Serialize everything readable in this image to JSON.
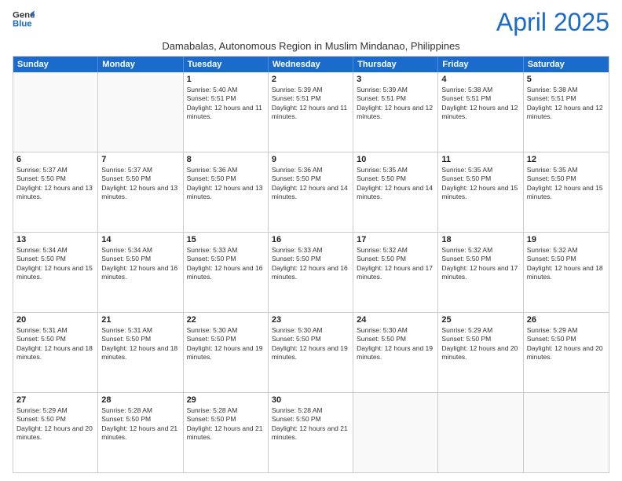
{
  "logo": {
    "line1": "General",
    "line2": "Blue"
  },
  "title": "April 2025",
  "subtitle": "Damabalas, Autonomous Region in Muslim Mindanao, Philippines",
  "header_days": [
    "Sunday",
    "Monday",
    "Tuesday",
    "Wednesday",
    "Thursday",
    "Friday",
    "Saturday"
  ],
  "rows": [
    [
      {
        "day": "",
        "text": ""
      },
      {
        "day": "",
        "text": ""
      },
      {
        "day": "1",
        "text": "Sunrise: 5:40 AM\nSunset: 5:51 PM\nDaylight: 12 hours and 11 minutes."
      },
      {
        "day": "2",
        "text": "Sunrise: 5:39 AM\nSunset: 5:51 PM\nDaylight: 12 hours and 11 minutes."
      },
      {
        "day": "3",
        "text": "Sunrise: 5:39 AM\nSunset: 5:51 PM\nDaylight: 12 hours and 12 minutes."
      },
      {
        "day": "4",
        "text": "Sunrise: 5:38 AM\nSunset: 5:51 PM\nDaylight: 12 hours and 12 minutes."
      },
      {
        "day": "5",
        "text": "Sunrise: 5:38 AM\nSunset: 5:51 PM\nDaylight: 12 hours and 12 minutes."
      }
    ],
    [
      {
        "day": "6",
        "text": "Sunrise: 5:37 AM\nSunset: 5:50 PM\nDaylight: 12 hours and 13 minutes."
      },
      {
        "day": "7",
        "text": "Sunrise: 5:37 AM\nSunset: 5:50 PM\nDaylight: 12 hours and 13 minutes."
      },
      {
        "day": "8",
        "text": "Sunrise: 5:36 AM\nSunset: 5:50 PM\nDaylight: 12 hours and 13 minutes."
      },
      {
        "day": "9",
        "text": "Sunrise: 5:36 AM\nSunset: 5:50 PM\nDaylight: 12 hours and 14 minutes."
      },
      {
        "day": "10",
        "text": "Sunrise: 5:35 AM\nSunset: 5:50 PM\nDaylight: 12 hours and 14 minutes."
      },
      {
        "day": "11",
        "text": "Sunrise: 5:35 AM\nSunset: 5:50 PM\nDaylight: 12 hours and 15 minutes."
      },
      {
        "day": "12",
        "text": "Sunrise: 5:35 AM\nSunset: 5:50 PM\nDaylight: 12 hours and 15 minutes."
      }
    ],
    [
      {
        "day": "13",
        "text": "Sunrise: 5:34 AM\nSunset: 5:50 PM\nDaylight: 12 hours and 15 minutes."
      },
      {
        "day": "14",
        "text": "Sunrise: 5:34 AM\nSunset: 5:50 PM\nDaylight: 12 hours and 16 minutes."
      },
      {
        "day": "15",
        "text": "Sunrise: 5:33 AM\nSunset: 5:50 PM\nDaylight: 12 hours and 16 minutes."
      },
      {
        "day": "16",
        "text": "Sunrise: 5:33 AM\nSunset: 5:50 PM\nDaylight: 12 hours and 16 minutes."
      },
      {
        "day": "17",
        "text": "Sunrise: 5:32 AM\nSunset: 5:50 PM\nDaylight: 12 hours and 17 minutes."
      },
      {
        "day": "18",
        "text": "Sunrise: 5:32 AM\nSunset: 5:50 PM\nDaylight: 12 hours and 17 minutes."
      },
      {
        "day": "19",
        "text": "Sunrise: 5:32 AM\nSunset: 5:50 PM\nDaylight: 12 hours and 18 minutes."
      }
    ],
    [
      {
        "day": "20",
        "text": "Sunrise: 5:31 AM\nSunset: 5:50 PM\nDaylight: 12 hours and 18 minutes."
      },
      {
        "day": "21",
        "text": "Sunrise: 5:31 AM\nSunset: 5:50 PM\nDaylight: 12 hours and 18 minutes."
      },
      {
        "day": "22",
        "text": "Sunrise: 5:30 AM\nSunset: 5:50 PM\nDaylight: 12 hours and 19 minutes."
      },
      {
        "day": "23",
        "text": "Sunrise: 5:30 AM\nSunset: 5:50 PM\nDaylight: 12 hours and 19 minutes."
      },
      {
        "day": "24",
        "text": "Sunrise: 5:30 AM\nSunset: 5:50 PM\nDaylight: 12 hours and 19 minutes."
      },
      {
        "day": "25",
        "text": "Sunrise: 5:29 AM\nSunset: 5:50 PM\nDaylight: 12 hours and 20 minutes."
      },
      {
        "day": "26",
        "text": "Sunrise: 5:29 AM\nSunset: 5:50 PM\nDaylight: 12 hours and 20 minutes."
      }
    ],
    [
      {
        "day": "27",
        "text": "Sunrise: 5:29 AM\nSunset: 5:50 PM\nDaylight: 12 hours and 20 minutes."
      },
      {
        "day": "28",
        "text": "Sunrise: 5:28 AM\nSunset: 5:50 PM\nDaylight: 12 hours and 21 minutes."
      },
      {
        "day": "29",
        "text": "Sunrise: 5:28 AM\nSunset: 5:50 PM\nDaylight: 12 hours and 21 minutes."
      },
      {
        "day": "30",
        "text": "Sunrise: 5:28 AM\nSunset: 5:50 PM\nDaylight: 12 hours and 21 minutes."
      },
      {
        "day": "",
        "text": ""
      },
      {
        "day": "",
        "text": ""
      },
      {
        "day": "",
        "text": ""
      }
    ]
  ]
}
